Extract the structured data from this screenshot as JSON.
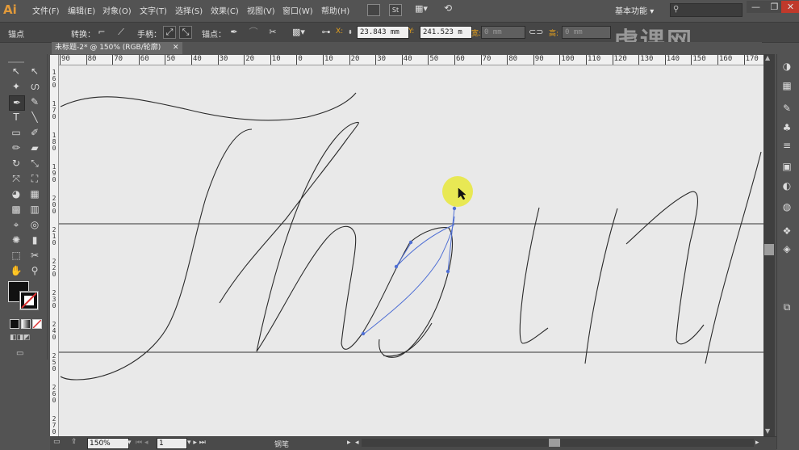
{
  "app": {
    "logo": "Ai"
  },
  "menu": [
    "文件(F)",
    "编辑(E)",
    "对象(O)",
    "文字(T)",
    "选择(S)",
    "效果(C)",
    "视图(V)",
    "窗口(W)",
    "帮助(H)"
  ],
  "menubar_buttons": {
    "st": "St"
  },
  "workspace": {
    "label": "基本功能",
    "arrow": "▾"
  },
  "window_buttons": [
    "—",
    "❐",
    "✕"
  ],
  "controlbar": {
    "anchor_label": "锚点",
    "convert_label": "转换：",
    "handles_label": "手柄：",
    "anchors_label": "锚点：",
    "x_label": "X:",
    "x_value": "23.843 mm",
    "y_label": "Y:",
    "y_value": "241.523 m",
    "w_label": "宽:",
    "w_value": "0 mm",
    "h_label": "高:",
    "h_value": "0 mm"
  },
  "document": {
    "tab_label": "未标题-2* @ 150% (RGB/轮廓)",
    "tab_close": "✕"
  },
  "ruler": {
    "h_ticks": [
      "90",
      "80",
      "70",
      "60",
      "50",
      "40",
      "30",
      "20",
      "10",
      "0",
      "10",
      "20",
      "30",
      "40",
      "50",
      "60",
      "70",
      "80",
      "90",
      "100",
      "110",
      "120",
      "130",
      "140",
      "150",
      "160",
      "170"
    ],
    "v_ticks": [
      "1\n6\n0",
      "1\n7\n0",
      "1\n8\n0",
      "1\n9\n0",
      "2\n0\n0",
      "2\n1\n0",
      "2\n2\n0",
      "2\n3\n0",
      "2\n4\n0",
      "2\n5\n0",
      "2\n6\n0",
      "2\n7\n0"
    ]
  },
  "statusbar": {
    "zoom": "150%",
    "artboard": "1",
    "tool_name": "钢笔"
  },
  "watermark": "虎课网",
  "tools": [
    [
      "selection-icon",
      "↖",
      "direct-selection-icon",
      "↖"
    ],
    [
      "magic-wand-icon",
      "✦",
      "lasso-icon",
      "ഗ"
    ],
    [
      "pen-icon",
      "✒",
      "curvature-icon",
      "✎"
    ],
    [
      "type-icon",
      "T",
      "line-segment-icon",
      "╲"
    ],
    [
      "rectangle-icon",
      "▭",
      "paintbrush-icon",
      "✐"
    ],
    [
      "pencil-icon",
      "✏",
      "eraser-icon",
      "▰"
    ],
    [
      "rotate-icon",
      "↻",
      "scale-icon",
      "⤡"
    ],
    [
      "width-icon",
      "⤧",
      "free-transform-icon",
      "⛶"
    ],
    [
      "shape-builder-icon",
      "◕",
      "perspective-icon",
      "▦"
    ],
    [
      "mesh-icon",
      "▩",
      "gradient-icon",
      "▥"
    ],
    [
      "eyedropper-icon",
      "⌖",
      "blend-icon",
      "◎"
    ],
    [
      "symbol-sprayer-icon",
      "✺",
      "graph-icon",
      "▮"
    ],
    [
      "artboard-icon",
      "⬚",
      "slice-icon",
      "✂"
    ],
    [
      "hand-icon",
      "✋",
      "zoom-icon",
      "⚲"
    ]
  ],
  "right_panel_icons": [
    "palette-icon",
    "swatches-icon",
    "brushes-icon",
    "symbols-icon",
    "stroke-icon",
    "gradient-panel-icon",
    "transparency-icon",
    "appearance-icon",
    "graphic-styles-icon",
    "layers-icon",
    "artboards-icon"
  ]
}
